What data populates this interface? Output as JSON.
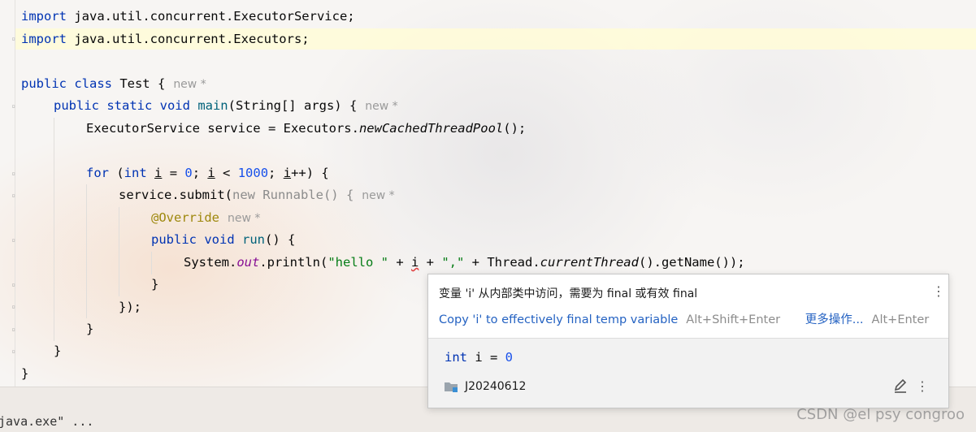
{
  "code": {
    "line1": {
      "kw": "import",
      "rest": " java.util.concurrent.ExecutorService;"
    },
    "line2": {
      "kw": "import",
      "rest": " java.util.concurrent.Executors;"
    },
    "line4": {
      "kw": "public class",
      "name": " Test {",
      "hint": "new *"
    },
    "line5": {
      "kw": "public static void",
      "name": " main",
      "rest": "(String[] args) {",
      "hint": "new *"
    },
    "line6": {
      "a": "ExecutorService service = Executors.",
      "b": "newCachedThreadPool",
      "c": "();"
    },
    "line8": {
      "kw1": "for",
      "p1": " (",
      "kw2": "int",
      "p2": " ",
      "v1": "i",
      "p3": " = ",
      "n1": "0",
      "p4": "; ",
      "v2": "i",
      "p5": " < ",
      "n2": "1000",
      "p6": "; ",
      "v3": "i",
      "p7": "++) {"
    },
    "line9": {
      "a": "service.submit(",
      "b": "new Runnable() {",
      "hint": "new *"
    },
    "line10": {
      "ann": "@Override",
      "hint": "new *"
    },
    "line11": {
      "kw": "public void",
      "name": " run",
      "rest": "() {"
    },
    "line12": {
      "a": "System.",
      "field": "out",
      "b": ".println(",
      "s1": "\"hello \"",
      "c": " + ",
      "v": "i",
      "d": " + ",
      "s2": "\",\"",
      "e": " + Thread.",
      "f": "currentThread",
      "g": "().getName());"
    },
    "line13": "}",
    "line14": "});",
    "line15": "}",
    "line16": "}",
    "line17": "}"
  },
  "popup": {
    "message": "变量 'i' 从内部类中访问，需要为 final 或有效 final",
    "action_label": "Copy 'i' to effectively final temp variable",
    "action_shortcut": "Alt+Shift+Enter",
    "more_label": "更多操作...",
    "more_shortcut": "Alt+Enter",
    "decl_kw": "int",
    "decl_rest": " i = ",
    "decl_num": "0",
    "module_name": "J20240612"
  },
  "console": {
    "text": "java.exe\" ..."
  },
  "watermark": "CSDN @el psy congroo"
}
